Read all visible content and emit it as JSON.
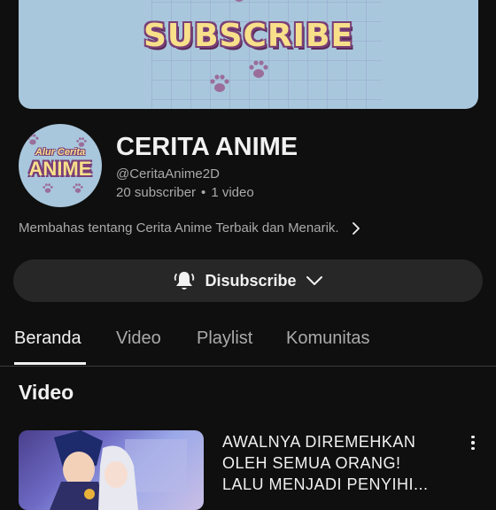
{
  "banner": {
    "text": "SUBSCRIBE"
  },
  "avatar": {
    "line1": "Alur Cerita",
    "line2": "ANIME"
  },
  "channel": {
    "name": "CERITA ANIME",
    "handle": "@CeritaAnime2D",
    "subscribers": "20 subscriber",
    "separator": "•",
    "videos": "1 video",
    "description": "Membahas tentang Cerita Anime Terbaik dan Menarik."
  },
  "subscribe_button": {
    "label": "Disubscribe",
    "icon": "bell-icon"
  },
  "tabs": [
    {
      "label": "Beranda",
      "active": true
    },
    {
      "label": "Video"
    },
    {
      "label": "Playlist"
    },
    {
      "label": "Komunitas"
    }
  ],
  "section": {
    "title": "Video"
  },
  "video": {
    "title": "AWALNYA DIREMEHKAN\nOLEH SEMUA ORANG!\nLALU MENJADI PENYIHI..."
  },
  "colors": {
    "background": "#0f0f0f",
    "banner": "#a9c7dc",
    "button": "#272727",
    "secondary_text": "#aaaaaa"
  }
}
